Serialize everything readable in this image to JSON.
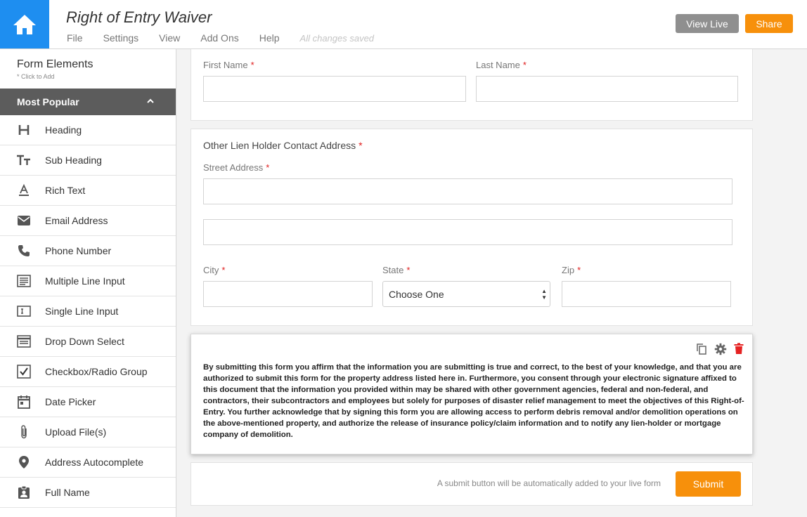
{
  "header": {
    "title": "Right of Entry Waiver",
    "menu": [
      "File",
      "Settings",
      "View",
      "Add Ons",
      "Help"
    ],
    "save_status": "All changes saved",
    "view_live_label": "View Live",
    "share_label": "Share",
    "home_icon": "home-icon"
  },
  "sidebar": {
    "title": "Form Elements",
    "hint": "* Click to Add",
    "section": "Most Popular",
    "items": [
      {
        "label": "Heading",
        "icon": "heading-icon"
      },
      {
        "label": "Sub Heading",
        "icon": "subheading-icon"
      },
      {
        "label": "Rich Text",
        "icon": "rich-text-icon"
      },
      {
        "label": "Email Address",
        "icon": "email-icon"
      },
      {
        "label": "Phone Number",
        "icon": "phone-icon"
      },
      {
        "label": "Multiple Line Input",
        "icon": "multiline-icon"
      },
      {
        "label": "Single Line Input",
        "icon": "single-line-icon"
      },
      {
        "label": "Drop Down Select",
        "icon": "dropdown-icon"
      },
      {
        "label": "Checkbox/Radio Group",
        "icon": "checkbox-icon"
      },
      {
        "label": "Date Picker",
        "icon": "calendar-icon"
      },
      {
        "label": "Upload File(s)",
        "icon": "paperclip-icon"
      },
      {
        "label": "Address Autocomplete",
        "icon": "location-pin-icon"
      },
      {
        "label": "Full Name",
        "icon": "contact-badge-icon"
      }
    ]
  },
  "form": {
    "name_card": {
      "first_name_label": "First Name",
      "last_name_label": "Last Name"
    },
    "address_card": {
      "title": "Other Lien Holder Contact Address",
      "street_label": "Street Address",
      "city_label": "City",
      "state_label": "State",
      "state_value": "Choose One",
      "zip_label": "Zip"
    },
    "required_mark": "*",
    "rich_text": "By submitting this form you affirm that the information you are submitting is true and correct, to the best of your knowledge, and that you are authorized to submit this form for the property address listed here in. Furthermore, you consent through your electronic signature affixed to this document that the information you provided within may be shared with other government agencies, federal and non-federal, and contractors, their subcontractors and employees but solely for purposes of disaster relief management to meet the objectives of this Right-of-Entry.  You further acknowledge that by signing this form you are allowing access to perform debris removal and/or demolition operations on the above-mentioned property, and authorize the release of insurance policy/claim information and to notify any lien-holder or mortgage company of demolition.",
    "submit_note": "A submit button will be automatically added to your live form",
    "submit_label": "Submit"
  },
  "colors": {
    "home_blue": "#1e8ef0",
    "accent_orange": "#f7900b",
    "required_red": "#e02020",
    "delete_red": "#e52222",
    "section_gray": "#5c5c5c"
  }
}
